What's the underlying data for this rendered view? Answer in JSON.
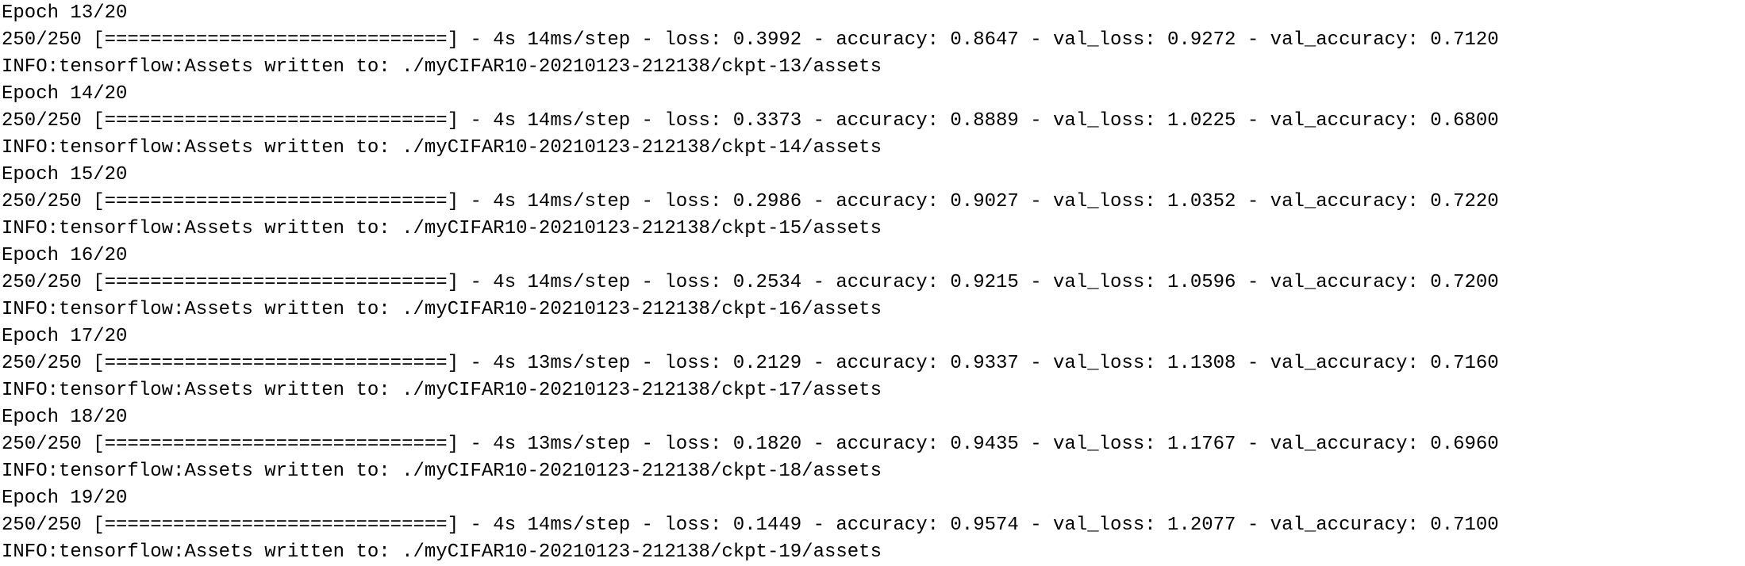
{
  "terminal": {
    "lines": [
      "Epoch 13/20",
      "250/250 [==============================] - 4s 14ms/step - loss: 0.3992 - accuracy: 0.8647 - val_loss: 0.9272 - val_accuracy: 0.7120",
      "INFO:tensorflow:Assets written to: ./myCIFAR10-20210123-212138/ckpt-13/assets",
      "Epoch 14/20",
      "250/250 [==============================] - 4s 14ms/step - loss: 0.3373 - accuracy: 0.8889 - val_loss: 1.0225 - val_accuracy: 0.6800",
      "INFO:tensorflow:Assets written to: ./myCIFAR10-20210123-212138/ckpt-14/assets",
      "Epoch 15/20",
      "250/250 [==============================] - 4s 14ms/step - loss: 0.2986 - accuracy: 0.9027 - val_loss: 1.0352 - val_accuracy: 0.7220",
      "INFO:tensorflow:Assets written to: ./myCIFAR10-20210123-212138/ckpt-15/assets",
      "Epoch 16/20",
      "250/250 [==============================] - 4s 14ms/step - loss: 0.2534 - accuracy: 0.9215 - val_loss: 1.0596 - val_accuracy: 0.7200",
      "INFO:tensorflow:Assets written to: ./myCIFAR10-20210123-212138/ckpt-16/assets",
      "Epoch 17/20",
      "250/250 [==============================] - 4s 13ms/step - loss: 0.2129 - accuracy: 0.9337 - val_loss: 1.1308 - val_accuracy: 0.7160",
      "INFO:tensorflow:Assets written to: ./myCIFAR10-20210123-212138/ckpt-17/assets",
      "Epoch 18/20",
      "250/250 [==============================] - 4s 13ms/step - loss: 0.1820 - accuracy: 0.9435 - val_loss: 1.1767 - val_accuracy: 0.6960",
      "INFO:tensorflow:Assets written to: ./myCIFAR10-20210123-212138/ckpt-18/assets",
      "Epoch 19/20",
      "250/250 [==============================] - 4s 14ms/step - loss: 0.1449 - accuracy: 0.9574 - val_loss: 1.2077 - val_accuracy: 0.7100",
      "INFO:tensorflow:Assets written to: ./myCIFAR10-20210123-212138/ckpt-19/assets"
    ]
  }
}
